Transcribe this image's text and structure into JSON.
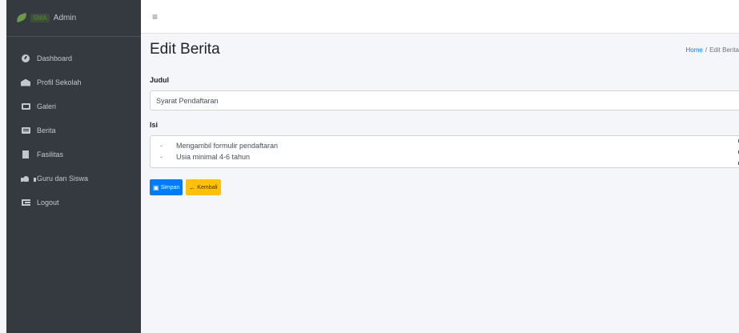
{
  "brand": {
    "logo_text": "SMA",
    "title": "Admin"
  },
  "sidebar": {
    "items": [
      {
        "label": "Dashboard",
        "icon": "dashboard-icon"
      },
      {
        "label": "Profil Sekolah",
        "icon": "school-icon"
      },
      {
        "label": "Galeri",
        "icon": "gallery-icon"
      },
      {
        "label": "Berita",
        "icon": "newspaper-icon"
      },
      {
        "label": "Fasilitas",
        "icon": "building-icon"
      },
      {
        "label": "Guru dan Siswa",
        "icon": "users-icon"
      },
      {
        "label": "Logout",
        "icon": "logout-icon"
      }
    ]
  },
  "topbar": {
    "menu_icon": "≡"
  },
  "page": {
    "title": "Edit Berita",
    "breadcrumb": {
      "home": "Home",
      "separator": "/",
      "current": "Edit Berita"
    }
  },
  "form": {
    "judul_label": "Judul",
    "judul_value": "Syarat Pendaftaran",
    "isi_label": "Isi",
    "isi_lines": [
      {
        "bullet": "-",
        "text": "Mengambil formulir pendaftaran"
      },
      {
        "bullet": "-",
        "text": "Usia minimal 4-6 tahun"
      }
    ],
    "save_label": "Simpan",
    "save_icon": "save-icon",
    "back_label": "Kembali",
    "back_icon": "arrow-left-icon"
  },
  "colors": {
    "sidebar_bg": "#343a40",
    "primary": "#007bff",
    "warning": "#ffc107",
    "content_bg": "#f4f6f9"
  }
}
